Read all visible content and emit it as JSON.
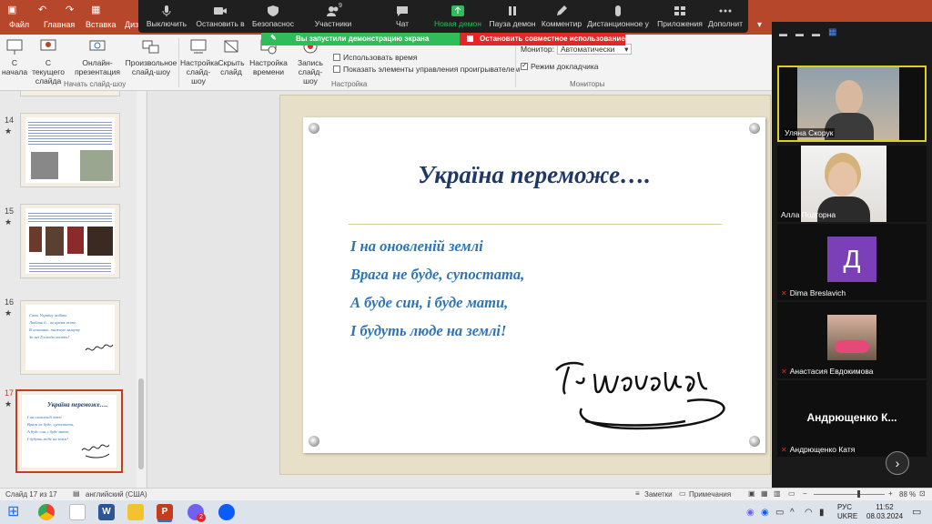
{
  "app": {
    "menu_tabs": [
      "Файл",
      "Главная",
      "Вставка",
      "Диз"
    ]
  },
  "ribbon": {
    "buttons": [
      {
        "label": "С начала"
      },
      {
        "label": "С текущего слайда"
      },
      {
        "label": "Онлайн-презентация"
      },
      {
        "label": "Произвольное слайд-шоу"
      },
      {
        "label": "Настройка слайд-шоу"
      },
      {
        "label": "Скрыть слайд"
      },
      {
        "label": "Настройка времени"
      },
      {
        "label": "Запись слайд-шоу"
      }
    ],
    "groups": [
      "Начать слайд-шоу",
      "Настройка",
      "Мониторы"
    ],
    "checkboxes": [
      {
        "label": "Использовать время",
        "checked": false
      },
      {
        "label": "Показать элементы управления проигрывателем",
        "checked": false
      },
      {
        "label": "Режим докладчика",
        "checked": true
      }
    ],
    "monitor_label": "Монитор:",
    "monitor_value": "Автоматически"
  },
  "zoom_toolbar": {
    "items": [
      {
        "label": "Выключить",
        "icon": "mic-icon"
      },
      {
        "label": "Остановить в",
        "icon": "video-icon"
      },
      {
        "label": "Безопаснос",
        "icon": "shield-icon"
      },
      {
        "label": "Участники",
        "icon": "participants-icon",
        "badge": "9"
      },
      {
        "label": "Чат",
        "icon": "chat-icon"
      },
      {
        "label": "Новая демон",
        "icon": "share-icon"
      },
      {
        "label": "Пауза демон",
        "icon": "pause-icon"
      },
      {
        "label": "Комментир",
        "icon": "pen-icon"
      },
      {
        "label": "Дистанционное у",
        "icon": "mouse-icon"
      },
      {
        "label": "Приложения",
        "icon": "apps-icon"
      },
      {
        "label": "Дополнит",
        "icon": "more-icon"
      }
    ],
    "sharing_banner": "Вы запустили демонстрацию экрана",
    "stop_share": "Остановить совместное использование"
  },
  "thumbnails": [
    {
      "num": "14"
    },
    {
      "num": "15"
    },
    {
      "num": "16",
      "lines": [
        "Свою Україну любіть",
        "Любіть її... во время люте.",
        "В останню, тяжкую минуту",
        "За неї Господа моліть!"
      ]
    },
    {
      "num": "17",
      "title": "Україна переможе….",
      "lines": [
        "І на оновленій землі",
        "Врага не буде, супостата,",
        "А буде син, і буде мати,",
        "І будуть люде на землі!"
      ]
    }
  ],
  "slide": {
    "title": "Україна переможе….",
    "lines": [
      "І на оновленій землі",
      "Врага не буде, супостата,",
      "А буде син, і буде мати,",
      "І будуть люде на землі!"
    ]
  },
  "gallery": {
    "participants": [
      {
        "name": "Уляна Скорук"
      },
      {
        "name": "Алла Подгорна"
      },
      {
        "name": "Dima Breslavich",
        "initial": "Д"
      },
      {
        "name": "Анастасия Евдокимова"
      },
      {
        "name": "Андрющенко Катя",
        "big_name": "Андрющенко  К..."
      }
    ]
  },
  "statusbar": {
    "slide_info": "Слайд 17 из 17",
    "language": "английский (США)",
    "notes": "Заметки",
    "comments": "Примечания",
    "zoom": "88 %"
  },
  "taskbar": {
    "lang_top": "РУС",
    "lang_bottom": "UKRE",
    "time": "11:52",
    "date": "08.03.2024",
    "badge": "2"
  },
  "colors": {
    "ppt_red": "#b7472a",
    "slide_blue": "#2e74b5",
    "title_navy": "#1f3864",
    "zoom_green": "#2ebd59",
    "stop_red": "#e02828"
  }
}
